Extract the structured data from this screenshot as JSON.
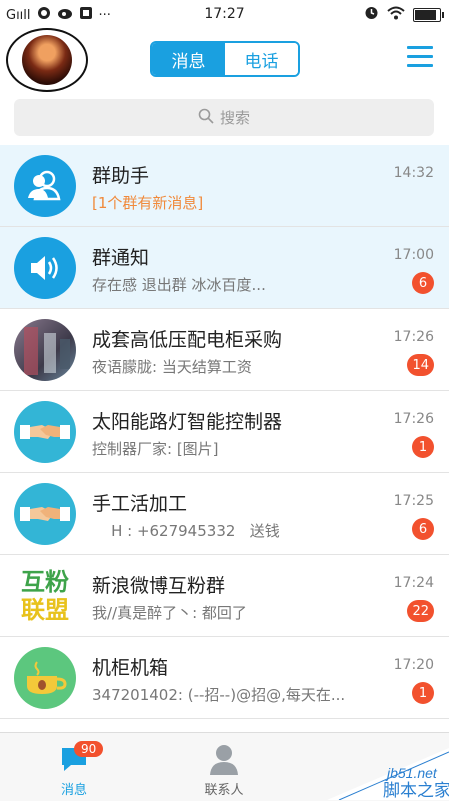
{
  "status_bar": {
    "signal": "Gııll",
    "more": "···",
    "time": "17:27"
  },
  "header": {
    "tabs": [
      {
        "label": "消息",
        "active": true
      },
      {
        "label": "电话",
        "active": false
      }
    ]
  },
  "search": {
    "placeholder": "搜索"
  },
  "conversations": [
    {
      "name": "群助手",
      "message": "[1个群有新消息]",
      "time": "14:32",
      "badge": "",
      "icon": "group-helper-icon",
      "icon_color": "#1aa0e0"
    },
    {
      "name": "群通知",
      "message": "存在感 退出群 冰冰百度...",
      "time": "17:00",
      "badge": "6",
      "icon": "speaker-icon",
      "icon_color": "#1aa0e0"
    },
    {
      "name": "成套高低压配电柜采购",
      "message": "夜语朦胧: 当天结算工资",
      "time": "17:26",
      "badge": "14",
      "icon": "photo-avatar",
      "icon_color": "#6b5a6e"
    },
    {
      "name": "太阳能路灯智能控制器",
      "message": "控制器厂家: [图片]",
      "time": "17:26",
      "badge": "1",
      "icon": "handshake-icon",
      "icon_color": "#33b5d6"
    },
    {
      "name": "手工活加工",
      "message": "    H : +627945332   送钱",
      "time": "17:25",
      "badge": "6",
      "icon": "handshake-icon",
      "icon_color": "#33b5d6"
    },
    {
      "name": "新浪微博互粉群",
      "message": "我//真是醉了丶: 都回了",
      "time": "17:24",
      "badge": "22",
      "icon": "hufen-logo",
      "icon_color": "#ffffff"
    },
    {
      "name": "机柜机箱",
      "message": "347201402: (--招--)@招@,每天在...",
      "time": "17:20",
      "badge": "1",
      "icon": "coffee-cup-icon",
      "icon_color": "#5cc77e"
    }
  ],
  "logo_texts": {
    "hufen_top": "互粉",
    "hufen_bottom": "联盟"
  },
  "tabbar": {
    "messages_label": "消息",
    "messages_badge": "90",
    "contacts_label": "联系人"
  },
  "watermark": {
    "site": "jb51.net",
    "name": "脚本之家"
  },
  "colors": {
    "accent": "#1aa0e0",
    "badge": "#f2512e",
    "highlight_row": "#e9f6fd"
  }
}
